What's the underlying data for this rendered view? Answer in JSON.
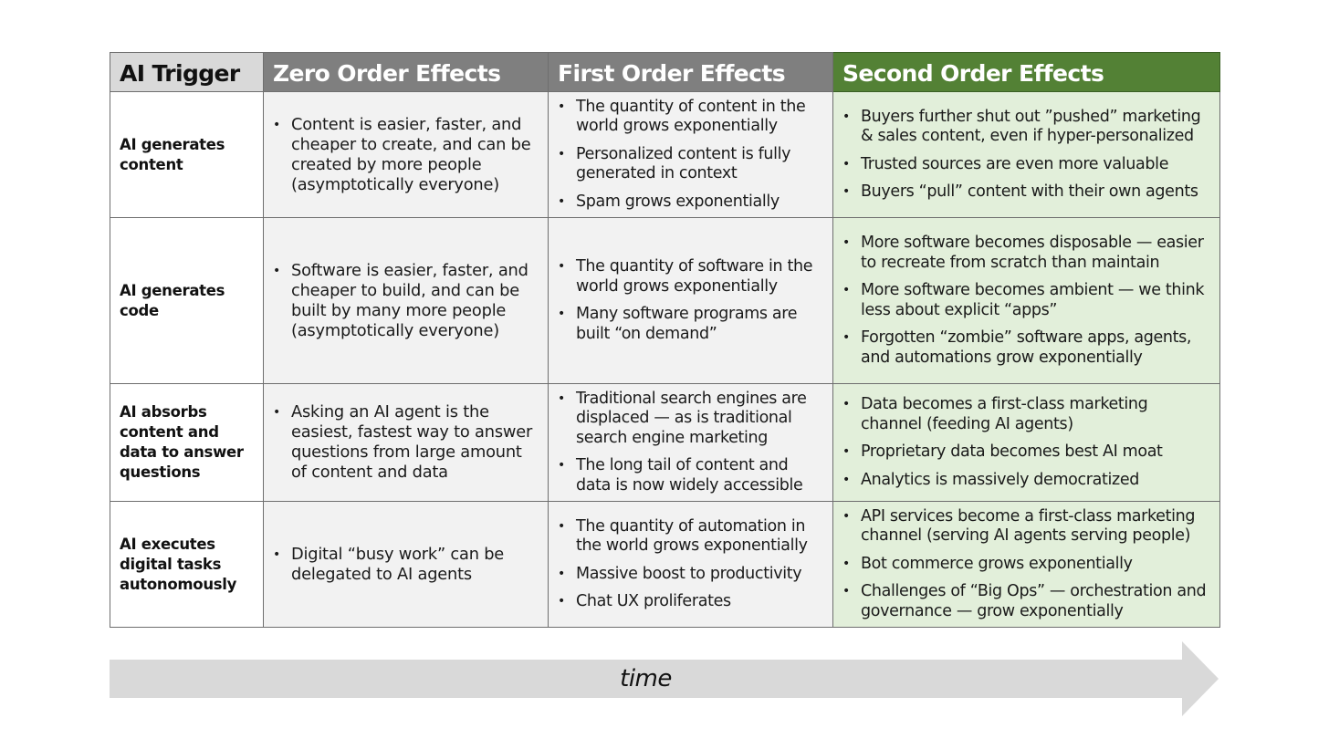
{
  "table": {
    "headers": {
      "trigger": "AI Trigger",
      "zero": "Zero Order Effects",
      "first": "First Order Effects",
      "second": "Second Order Effects"
    },
    "colors": {
      "trigger_header_bg": "#d9d9d9",
      "zero_first_header_bg": "#7f7f7f",
      "second_header_bg": "#538135",
      "zero_first_cell_bg": "#f2f2f2",
      "second_cell_bg": "#e2efda"
    },
    "rows": [
      {
        "trigger": "AI generates content",
        "zero": [
          "Content is easier, faster, and cheaper to create, and can be created by more people (asymptotically everyone)"
        ],
        "first": [
          "The quantity of content in the world grows exponentially",
          "Personalized content is fully generated in context",
          "Spam grows exponentially"
        ],
        "second": [
          "Buyers further shut out ”pushed” marketing & sales content, even if hyper-personalized",
          "Trusted sources are even more valuable",
          "Buyers “pull” content with their own agents"
        ]
      },
      {
        "trigger": "AI generates code",
        "zero": [
          "Software is easier, faster, and cheaper to build, and can be built by many more people (asymptotically everyone)"
        ],
        "first": [
          "The quantity of software in the world grows exponentially",
          "Many software programs are built “on demand”"
        ],
        "second": [
          "More software becomes disposable — easier to recreate from scratch than maintain",
          "More software becomes ambient — we think less about explicit “apps”",
          "Forgotten “zombie” software apps, agents, and automations grow exponentially"
        ]
      },
      {
        "trigger": "AI absorbs content and data to answer questions",
        "zero": [
          "Asking an AI agent is the easiest, fastest way to answer questions from large amount of content and data"
        ],
        "first": [
          "Traditional search engines are displaced — as is traditional search engine marketing",
          "The long tail of content and data is now widely accessible"
        ],
        "second": [
          "Data becomes a first-class marketing channel (feeding AI agents)",
          "Proprietary data becomes best AI moat",
          "Analytics is massively democratized"
        ]
      },
      {
        "trigger": "AI executes digital tasks autonomously",
        "zero": [
          "Digital “busy work” can be delegated to AI agents"
        ],
        "first": [
          "The quantity of automation in the world grows exponentially",
          "Massive boost to productivity",
          "Chat UX proliferates"
        ],
        "second": [
          "API services become a first-class marketing channel (serving AI agents serving people)",
          "Bot commerce grows exponentially",
          "Challenges of “Big Ops” — orchestration and governance — grow exponentially"
        ]
      }
    ]
  },
  "arrow": {
    "label": "time",
    "icon": "right-arrow-icon",
    "color": "#d9d9d9"
  },
  "bullet_glyph": "•"
}
